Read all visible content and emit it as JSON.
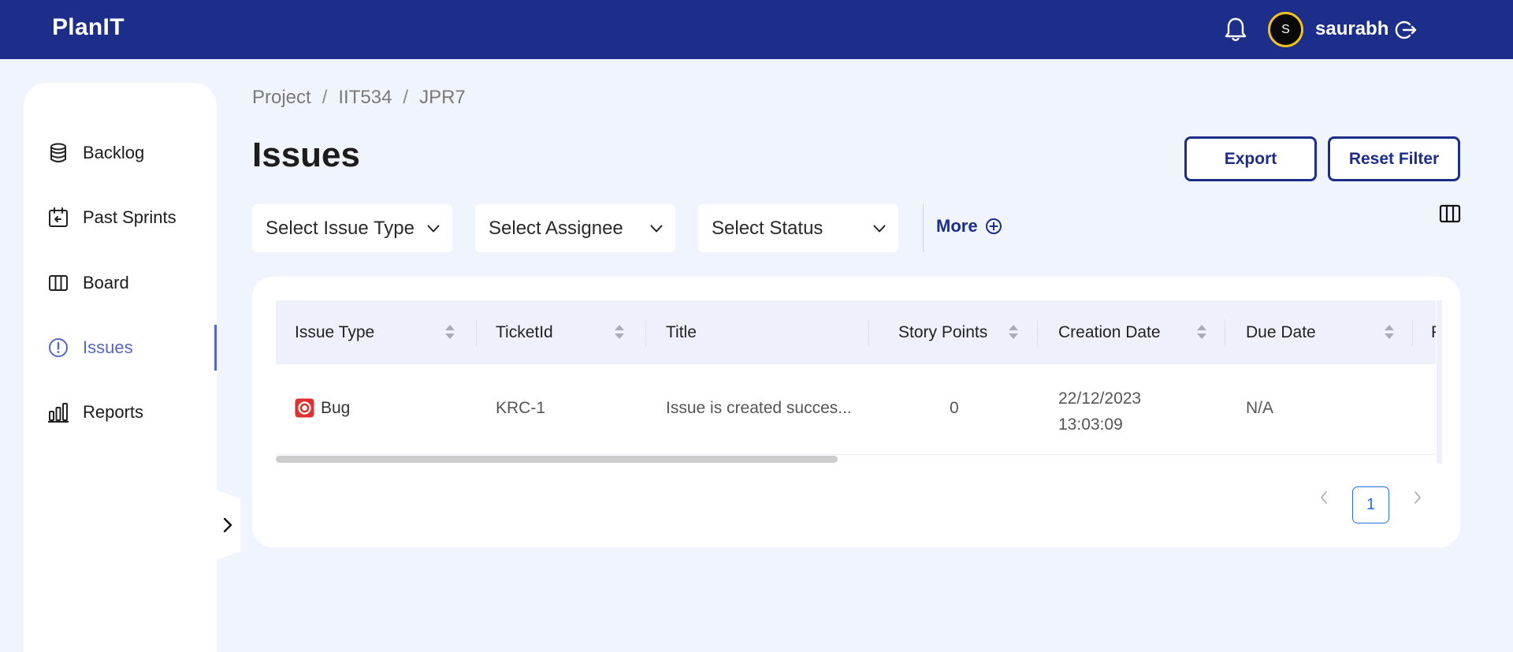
{
  "header": {
    "brand": "PlanIT",
    "notification_icon": "bell-icon",
    "avatar_initial": "S",
    "username": "saurabh",
    "logout_icon": "logout-icon"
  },
  "sidebar": {
    "items": [
      {
        "label": "Backlog",
        "icon": "database-icon",
        "active": false
      },
      {
        "label": "Past Sprints",
        "icon": "calendar-back-icon",
        "active": false
      },
      {
        "label": "Board",
        "icon": "board-columns-icon",
        "active": false
      },
      {
        "label": "Issues",
        "icon": "alert-circle-icon",
        "active": true
      },
      {
        "label": "Reports",
        "icon": "bar-chart-icon",
        "active": false
      }
    ],
    "collapse_icon": "chevron-right-icon"
  },
  "breadcrumb": [
    "Project",
    "IIT534",
    "JPR7"
  ],
  "page_title": "Issues",
  "actions": {
    "export": "Export",
    "reset_filter": "Reset Filter"
  },
  "filters": {
    "issue_type": "Select Issue Type",
    "assignee": "Select Assignee",
    "status": "Select Status",
    "more": "More"
  },
  "table": {
    "columns": [
      "Issue Type",
      "TicketId",
      "Title",
      "Story Points",
      "Creation Date",
      "Due Date",
      "P"
    ],
    "rows": [
      {
        "issue_type": "Bug",
        "ticket_id": "KRC-1",
        "title": "Issue is created succes...",
        "story_points": "0",
        "creation_date_line1": "22/12/2023",
        "creation_date_line2": "13:03:09",
        "due_date": "N/A"
      }
    ]
  },
  "pagination": {
    "current_page": "1"
  },
  "colors": {
    "primary": "#1d2d8a",
    "active_nav": "#5566c4",
    "bug": "#e03131",
    "page_link": "#1e6fe0"
  }
}
